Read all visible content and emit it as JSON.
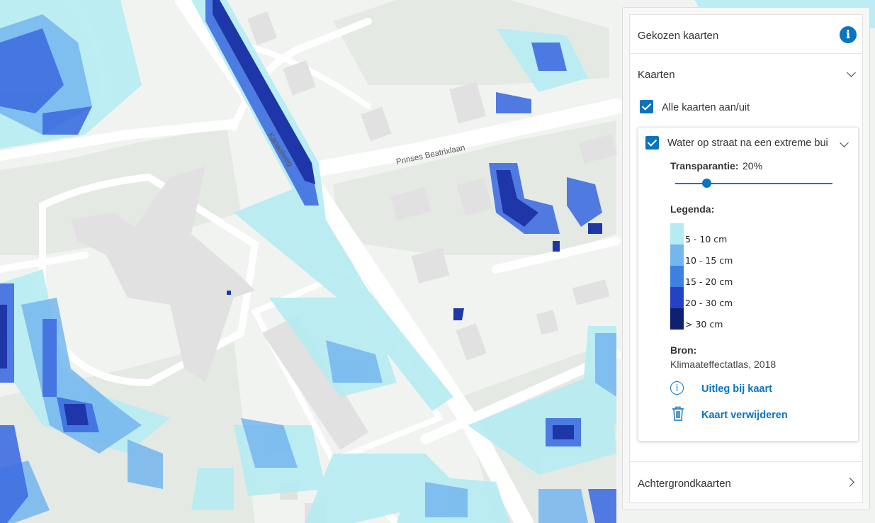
{
  "map": {
    "street_label_1": "Prinses Beatrixlaan",
    "street_label_2": "Kanaalweg"
  },
  "panel": {
    "title": "Gekozen kaarten",
    "info_icon": "info-icon",
    "kaarten_label": "Kaarten",
    "toggle_all_label": "Alle kaarten aan/uit",
    "toggle_all_checked": true,
    "layer": {
      "name": "Water op straat na een extreme bui",
      "checked": true,
      "transparency_label": "Transparantie:",
      "transparency_value": "20%",
      "transparency_fraction": 0.2,
      "legend_title": "Legenda:",
      "legend": [
        {
          "label": "5 - 10 cm",
          "color": "#b5ecf2"
        },
        {
          "label": "10 - 15 cm",
          "color": "#74b6ee"
        },
        {
          "label": "15 - 20 cm",
          "color": "#3f7fe0"
        },
        {
          "label": "20 - 30 cm",
          "color": "#2443c4"
        },
        {
          "label": "> 30 cm",
          "color": "#0f1f72"
        }
      ],
      "source_title": "Bron:",
      "source_value": "Klimaateffectatlas, 2018",
      "explain_link": "Uitleg bij kaart",
      "remove_link": "Kaart verwijderen"
    },
    "background_maps_label": "Achtergrondkaarten"
  },
  "colors": {
    "accent": "#0a73c2",
    "map_ground": "#f1f3f1",
    "park": "#e3e8e3",
    "building": "#e0e0e0"
  }
}
